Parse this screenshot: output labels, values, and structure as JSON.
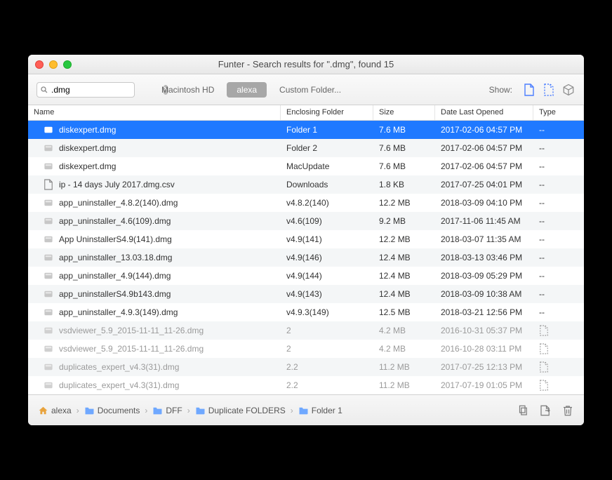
{
  "window": {
    "title": "Funter - Search results for \".dmg\", found 15"
  },
  "toolbar": {
    "search_value": ".dmg",
    "scope1": "Macintosh HD",
    "scope2": "alexa",
    "scope3": "Custom Folder...",
    "show_label": "Show:"
  },
  "columns": {
    "name": "Name",
    "folder": "Enclosing Folder",
    "size": "Size",
    "date": "Date Last Opened",
    "type": "Type"
  },
  "rows": [
    {
      "name": "diskexpert.dmg",
      "folder": "Folder 1",
      "size": "7.6 MB",
      "date": "2017-02-06 04:57 PM",
      "type": "--",
      "icon": "dmg",
      "selected": true
    },
    {
      "name": "diskexpert.dmg",
      "folder": "Folder 2",
      "size": "7.6 MB",
      "date": "2017-02-06 04:57 PM",
      "type": "--",
      "icon": "dmg"
    },
    {
      "name": "diskexpert.dmg",
      "folder": "MacUpdate",
      "size": "7.6 MB",
      "date": "2017-02-06 04:57 PM",
      "type": "--",
      "icon": "dmg"
    },
    {
      "name": "ip - 14 days July 2017.dmg.csv",
      "folder": "Downloads",
      "size": "1.8 KB",
      "date": "2017-07-25 04:01 PM",
      "type": "--",
      "icon": "doc"
    },
    {
      "name": "app_uninstaller_4.8.2(140).dmg",
      "folder": "v4.8.2(140)",
      "size": "12.2 MB",
      "date": "2018-03-09 04:10 PM",
      "type": "--",
      "icon": "dmg"
    },
    {
      "name": "app_uninstaller_4.6(109).dmg",
      "folder": "v4.6(109)",
      "size": "9.2 MB",
      "date": "2017-11-06 11:45 AM",
      "type": "--",
      "icon": "dmg"
    },
    {
      "name": "App UninstallerS4.9(141).dmg",
      "folder": "v4.9(141)",
      "size": "12.2 MB",
      "date": "2018-03-07 11:35 AM",
      "type": "--",
      "icon": "dmg"
    },
    {
      "name": "app_uninstaller_13.03.18.dmg",
      "folder": "v4.9(146)",
      "size": "12.4 MB",
      "date": "2018-03-13 03:46 PM",
      "type": "--",
      "icon": "dmg"
    },
    {
      "name": "app_uninstaller_4.9(144).dmg",
      "folder": "v4.9(144)",
      "size": "12.4 MB",
      "date": "2018-03-09 05:29 PM",
      "type": "--",
      "icon": "dmg"
    },
    {
      "name": "app_uninstallerS4.9b143.dmg",
      "folder": "v4.9(143)",
      "size": "12.4 MB",
      "date": "2018-03-09 10:38 AM",
      "type": "--",
      "icon": "dmg"
    },
    {
      "name": "app_uninstaller_4.9.3(149).dmg",
      "folder": "v4.9.3(149)",
      "size": "12.5 MB",
      "date": "2018-03-21 12:56 PM",
      "type": "--",
      "icon": "dmg"
    },
    {
      "name": "vsdviewer_5.9_2015-11-11_11-26.dmg",
      "folder": "2",
      "size": "4.2 MB",
      "date": "2016-10-31 05:37 PM",
      "type": "hidden",
      "icon": "dmg",
      "hidden": true
    },
    {
      "name": "vsdviewer_5.9_2015-11-11_11-26.dmg",
      "folder": "2",
      "size": "4.2 MB",
      "date": "2016-10-28 03:11 PM",
      "type": "hidden",
      "icon": "dmg",
      "hidden": true
    },
    {
      "name": "duplicates_expert_v4.3(31).dmg",
      "folder": "2.2",
      "size": "11.2 MB",
      "date": "2017-07-25 12:13 PM",
      "type": "hidden",
      "icon": "dmg",
      "hidden": true
    },
    {
      "name": "duplicates_expert_v4.3(31).dmg",
      "folder": "2.2",
      "size": "11.2 MB",
      "date": "2017-07-19 01:05 PM",
      "type": "hidden",
      "icon": "dmg",
      "hidden": true
    }
  ],
  "breadcrumb": [
    {
      "label": "alexa",
      "icon": "home"
    },
    {
      "label": "Documents",
      "icon": "folder"
    },
    {
      "label": "DFF",
      "icon": "folder"
    },
    {
      "label": "Duplicate FOLDERS",
      "icon": "folder"
    },
    {
      "label": "Folder 1",
      "icon": "folder"
    }
  ]
}
